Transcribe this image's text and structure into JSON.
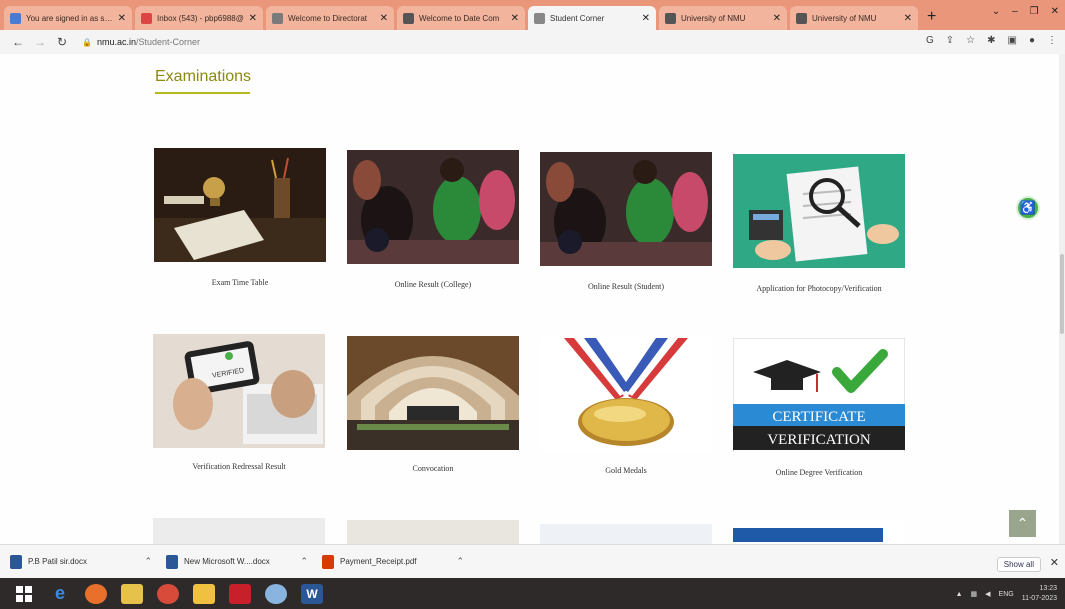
{
  "browser": {
    "tabs": [
      {
        "title": "You are signed in as staff",
        "fav_color": "#4a7bd0",
        "active": false
      },
      {
        "title": "Inbox (543) - pbp6988@",
        "fav_color": "#d44",
        "active": false
      },
      {
        "title": "Welcome to Directorat",
        "fav_color": "#7a7a7a",
        "active": false
      },
      {
        "title": "Welcome to Date Com",
        "fav_color": "#555",
        "active": false
      },
      {
        "title": "Student Corner",
        "fav_color": "#888",
        "active": true
      },
      {
        "title": "University of NMU",
        "fav_color": "#555",
        "active": false
      },
      {
        "title": "University of NMU",
        "fav_color": "#555",
        "active": false
      }
    ],
    "new_tab": "+",
    "url_host": "nmu.ac.in",
    "url_path": "/Student-Corner"
  },
  "page": {
    "section_title": "Examinations",
    "cards_row1": [
      {
        "label": "Exam Time Table"
      },
      {
        "label": "Online Result (College)"
      },
      {
        "label": "Online Result (Student)"
      },
      {
        "label": "Application for Photocopy/Verification"
      }
    ],
    "cards_row2": [
      {
        "label": "Verification Redressal Result"
      },
      {
        "label": "Convocation"
      },
      {
        "label": "Gold Medals"
      },
      {
        "label": "Online Degree Verification"
      }
    ],
    "verified_text": "VERIFIED",
    "certificate_line1": "CERTIFICATE",
    "certificate_line2": "VERIFICATION"
  },
  "downloads": {
    "items": [
      {
        "name": "P.B Patil sir.docx",
        "color": "#2b5797"
      },
      {
        "name": "New Microsoft W....docx",
        "color": "#2b5797"
      },
      {
        "name": "Payment_Receipt.pdf",
        "color": "#d83b01"
      }
    ],
    "show_all": "Show all"
  },
  "taskbar": {
    "language": "ENG",
    "time": "13:23",
    "date": "11-07-2023"
  },
  "colors": {
    "tab_strip": "#e9967a",
    "section_title": "#8a8a10",
    "accessibility": "#49b04a"
  }
}
